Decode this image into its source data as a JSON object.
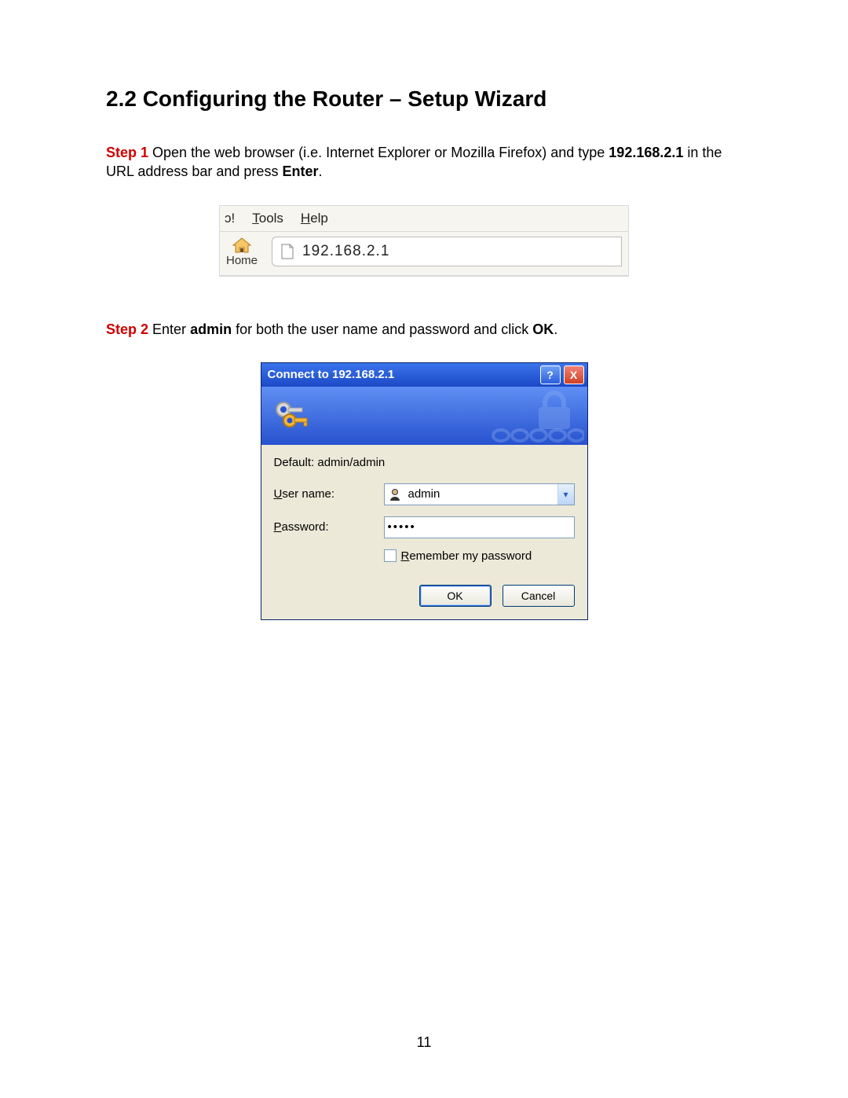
{
  "doc": {
    "section_title": "2.2 Configuring the Router – Setup Wizard",
    "step1_label": "Step 1",
    "step1_a": " Open the web browser (i.e. Internet Explorer or Mozilla Firefox) and type ",
    "step1_ip": "192.168.2.1",
    "step1_b": " in the URL address bar and press ",
    "step1_enter": "Enter",
    "step1_period": ".",
    "step2_label": "Step 2",
    "step2_a": " Enter ",
    "step2_admin": "admin",
    "step2_b": " for both the user name and password and click ",
    "step2_ok": "OK",
    "step2_period": ".",
    "page_number": "11"
  },
  "browser": {
    "menu_frag": "ɔ!",
    "menu_tools": "Tools",
    "menu_help": "Help",
    "home_label": "Home",
    "url": "192.168.2.1"
  },
  "dialog": {
    "title": "Connect to 192.168.2.1",
    "help_glyph": "?",
    "close_glyph": "X",
    "default_text": "Default: admin/admin",
    "username_label": "User name:",
    "username_value": "admin",
    "password_label": "Password:",
    "password_value": "•••••",
    "remember_label": "Remember my password",
    "ok_btn": "OK",
    "cancel_btn": "Cancel"
  }
}
